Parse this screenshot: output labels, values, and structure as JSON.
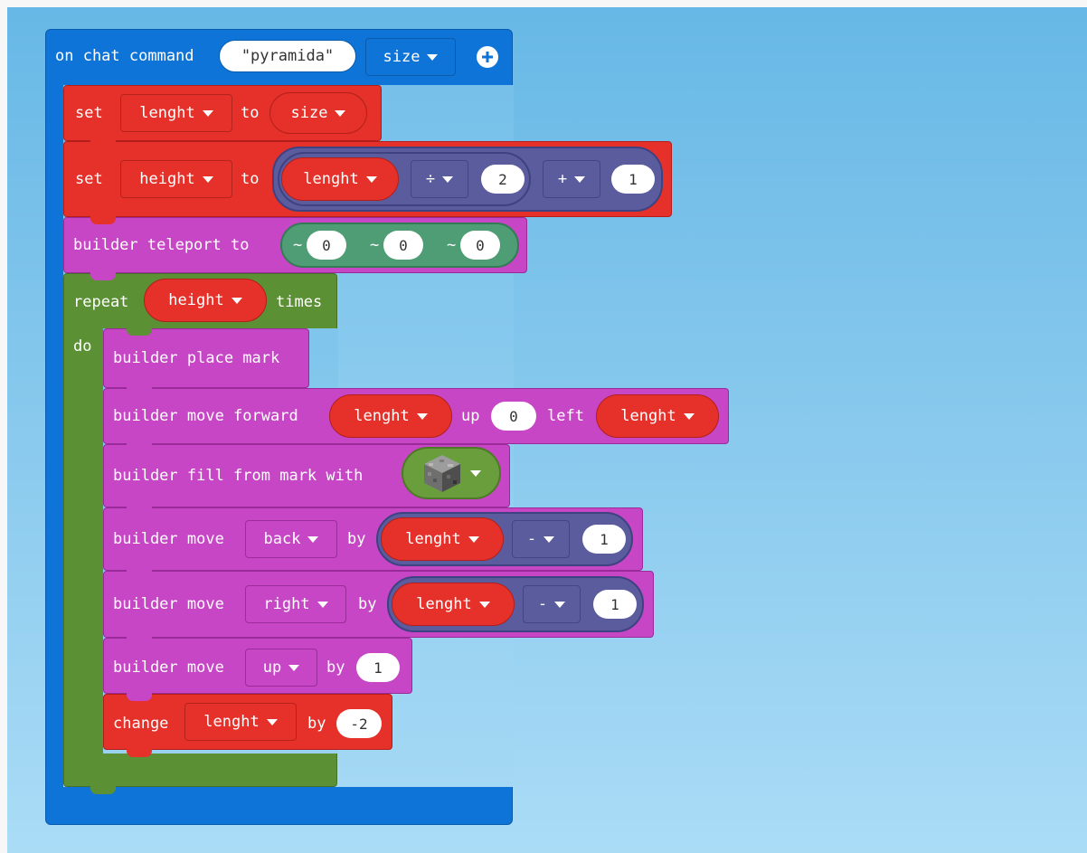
{
  "event": {
    "label": "on chat command",
    "command_value": "\"pyramida\"",
    "param_dropdown": "size"
  },
  "set_lenght": {
    "set_label": "set",
    "var": "lenght",
    "to_label": "to",
    "value": "size"
  },
  "set_height": {
    "set_label": "set",
    "var": "height",
    "to_label": "to",
    "math_var": "lenght",
    "div_op": "÷",
    "div_value": "2",
    "plus_op": "+",
    "plus_value": "1"
  },
  "teleport": {
    "label": "builder teleport to",
    "tilde": "~",
    "x": "0",
    "y": "0",
    "z": "0"
  },
  "repeat": {
    "label": "repeat",
    "var": "height",
    "times_label": "times",
    "do_label": "do"
  },
  "place_mark": {
    "label": "builder place mark"
  },
  "move_forward": {
    "label": "builder move forward",
    "forward_var": "lenght",
    "up_label": "up",
    "up_value": "0",
    "left_label": "left",
    "left_var": "lenght"
  },
  "fill": {
    "label": "builder fill from mark with",
    "block_icon": "cobblestone-block-icon"
  },
  "move_back": {
    "label": "builder move",
    "direction": "back",
    "by_label": "by",
    "var": "lenght",
    "op": "-",
    "value": "1"
  },
  "move_right": {
    "label": "builder move",
    "direction": "right",
    "by_label": "by",
    "var": "lenght",
    "op": "-",
    "value": "1"
  },
  "move_up": {
    "label": "builder move",
    "direction": "up",
    "by_label": "by",
    "value": "1"
  },
  "change": {
    "label": "change",
    "var": "lenght",
    "by_label": "by",
    "value": "-2"
  },
  "colors": {
    "event": "#0f74d7",
    "variables": "#e5312a",
    "builder": "#c646c5",
    "loops": "#5c9035",
    "math": "#5a5c9e",
    "position": "#4f9d74",
    "workspace": "#8ccbee"
  }
}
